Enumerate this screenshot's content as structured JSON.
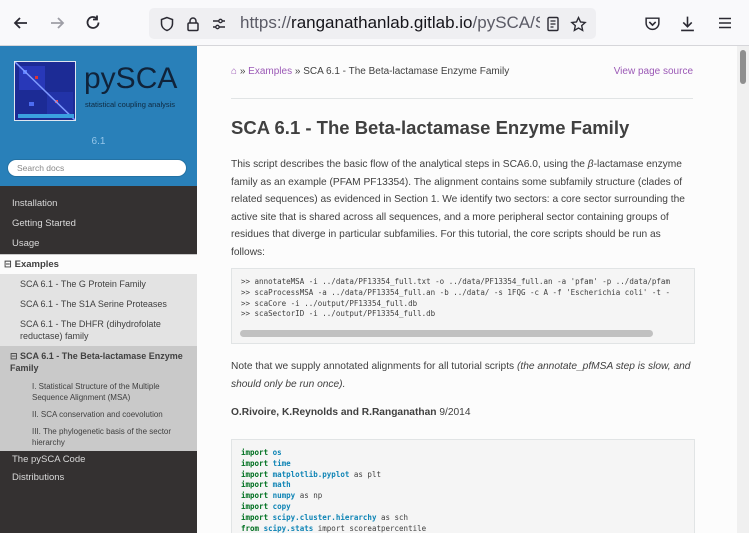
{
  "browser": {
    "url_scheme": "https://",
    "url_host": "ranganathanlab.gitlab.io",
    "url_path": "/pySCA/SC"
  },
  "sidebar": {
    "logo_title": "pySCA",
    "logo_subtitle": "statistical coupling analysis",
    "version": "6.1",
    "search_placeholder": "Search docs",
    "nav": [
      {
        "label": "Installation"
      },
      {
        "label": "Getting Started"
      },
      {
        "label": "Usage"
      }
    ],
    "current_section": "Examples",
    "examples": [
      {
        "label": "SCA 6.1 - The G Protein Family"
      },
      {
        "label": "SCA 6.1 - The S1A Serine Proteases"
      },
      {
        "label": "SCA 6.1 - The DHFR (dihydrofolate reductase) family"
      }
    ],
    "current_example": "SCA 6.1 - The Beta-lactamase Enzyme Family",
    "subsections": [
      {
        "label": "I. Statistical Structure of the Multiple Sequence Alignment (MSA)"
      },
      {
        "label": "II. SCA conservation and coevolution"
      },
      {
        "label": "III. The phylogenetic basis of the sector hierarchy"
      }
    ],
    "after": [
      {
        "label": "The pySCA Code"
      },
      {
        "label": "Distributions"
      }
    ]
  },
  "main": {
    "breadcrumb_examples": "Examples",
    "breadcrumb_sep1": "»",
    "breadcrumb_sep2": "»",
    "breadcrumb_current": "SCA 6.1 - The Beta-lactamase Enzyme Family",
    "view_source": "View page source",
    "title": "SCA 6.1 - The Beta-lactamase Enzyme Family",
    "intro_1": "This script describes the basic flow of the analytical steps in SCA6.0, using the ",
    "intro_beta": "β",
    "intro_2": "-lactamase enzyme family as an example (PFAM PF13354). The alignment contains some subfamily structure (clades of related sequences) as evidenced in Section 1. We identify two sectors: a core sector surrounding the active site that is shared across all sequences, and a more peripheral sector containing groups of residues that diverge in particular subfamilies. For this tutorial, the core scripts should be run as follows:",
    "cmd_lines": [
      ">> annotateMSA -i ../data/PF13354_full.txt -o ../data/PF13354_full.an -a 'pfam' -p ../data/pfam",
      ">> scaProcessMSA -a ../data/PF13354_full.an -b ../data/ -s 1FQG -c A -f 'Escherichia coli' -t -",
      ">> scaCore -i ../output/PF13354_full.db",
      ">> scaSectorID -i ../output/PF13354_full.db"
    ],
    "note_1": "Note that we supply annotated alignments for all tutorial scripts ",
    "note_italic": "(the annotate_pfMSA step is slow, and should only be run once).",
    "author_names": "O.Rivoire, K.Reynolds and R.Ranganathan",
    "author_date": "9/2014",
    "imports": [
      {
        "kw": "import",
        "mod": "os",
        "rest": ""
      },
      {
        "kw": "import",
        "mod": "time",
        "rest": ""
      },
      {
        "kw": "import",
        "mod": "matplotlib.pyplot",
        "rest": " as plt"
      },
      {
        "kw": "import",
        "mod": "math",
        "rest": ""
      },
      {
        "kw": "import",
        "mod": "numpy",
        "rest": " as np"
      },
      {
        "kw": "import",
        "mod": "copy",
        "rest": ""
      },
      {
        "kw": "import",
        "mod": "scipy.cluster.hierarchy",
        "rest": " as sch"
      },
      {
        "kw": "from",
        "mod": "scipy.stats",
        "rest": " import scoreatpercentile"
      }
    ]
  }
}
